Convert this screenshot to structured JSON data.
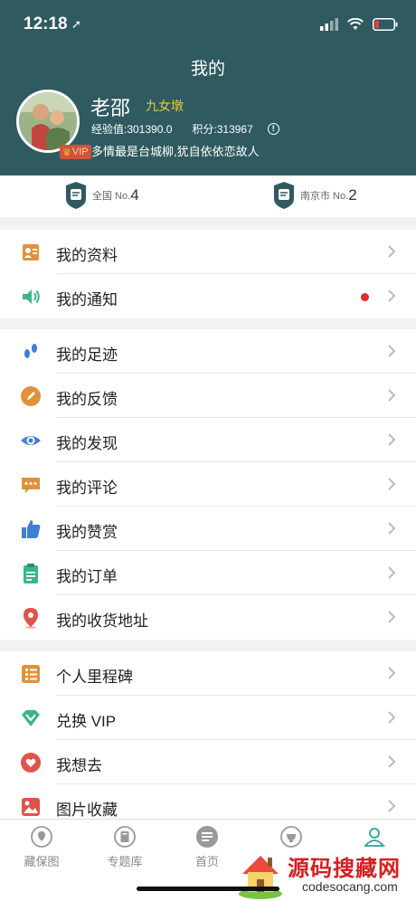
{
  "status_bar": {
    "time": "12:18"
  },
  "header": {
    "title": "我的",
    "user_name": "老邵",
    "user_rank": "九女墩",
    "exp_text": "经验值:301390.0",
    "points_text": "积分:313967",
    "info_icon": "!",
    "motto": "多情最是台城柳,犹自依依恋故人",
    "vip_label": "VIP"
  },
  "rank": {
    "national_label": "全国 No.",
    "national_value": "4",
    "city_label": "南京市 No.",
    "city_value": "2"
  },
  "group1": [
    {
      "label": "我的资料",
      "icon": "profile-card-icon"
    },
    {
      "label": "我的通知",
      "icon": "speaker-icon",
      "badge": true
    }
  ],
  "group2": [
    {
      "label": "我的足迹",
      "icon": "footprint-icon"
    },
    {
      "label": "我的反馈",
      "icon": "pen-icon"
    },
    {
      "label": "我的发现",
      "icon": "eye-icon"
    },
    {
      "label": "我的评论",
      "icon": "comment-icon"
    },
    {
      "label": "我的赞赏",
      "icon": "thumbs-up-icon"
    },
    {
      "label": "我的订单",
      "icon": "clipboard-icon"
    },
    {
      "label": "我的收货地址",
      "icon": "location-pin-icon"
    }
  ],
  "group3": [
    {
      "label": "个人里程碑",
      "icon": "checklist-icon"
    },
    {
      "label": "兑换 VIP",
      "icon": "diamond-icon"
    },
    {
      "label": "我想去",
      "icon": "heart-icon"
    },
    {
      "label": "图片收藏",
      "icon": "image-icon"
    }
  ],
  "tabs": [
    {
      "label": "藏保图"
    },
    {
      "label": "专题库"
    },
    {
      "label": "首页"
    },
    {
      "label": ""
    },
    {
      "label": ""
    }
  ],
  "watermark": {
    "title": "源码搜藏网",
    "url": "codesocang.com"
  },
  "colors": {
    "header_bg": "#2e5a60",
    "accent_orange": "#e0923b",
    "accent_green": "#3cb48a",
    "accent_blue": "#3f7fd6",
    "accent_red": "#e0534b",
    "gold": "#f0c63a"
  }
}
